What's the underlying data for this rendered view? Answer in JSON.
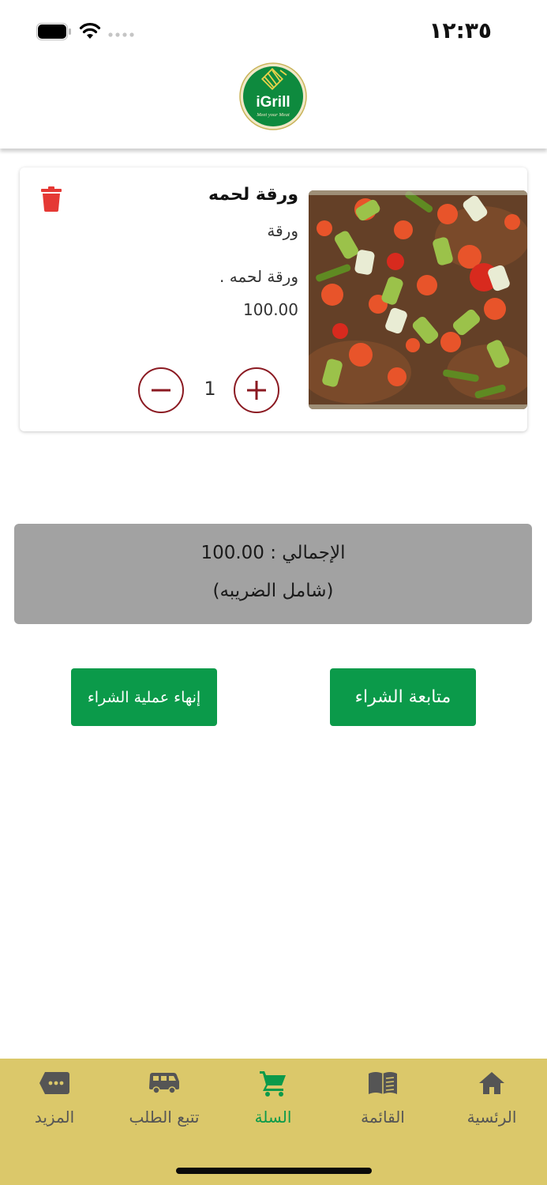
{
  "status_bar": {
    "time": "١٢:٣٥"
  },
  "header": {
    "logo_text": "iGrill",
    "logo_tagline": "Meet your Meat"
  },
  "cart_item": {
    "name": "ورقة لحمه",
    "subtitle": "ورقة",
    "description": "ورقة لحمه .",
    "price": "100.00",
    "quantity": "1"
  },
  "total": {
    "line": "الإجمالي : 100.00",
    "tax_note": "(شامل الضريبه)"
  },
  "actions": {
    "continue_label": "متابعة الشراء",
    "checkout_label": "إنهاء عملية الشراء"
  },
  "tabs": [
    {
      "label": "الرئسية",
      "icon": "home-icon"
    },
    {
      "label": "القائمة",
      "icon": "menu-book-icon"
    },
    {
      "label": "السلة",
      "icon": "cart-icon",
      "active": true
    },
    {
      "label": "تتبع الطلب",
      "icon": "delivery-van-icon"
    },
    {
      "label": "المزيد",
      "icon": "more-dots-icon"
    }
  ],
  "colors": {
    "brand_green": "#0b9a4a",
    "tabbar_bg": "#dbc86a",
    "delete_red": "#e53935",
    "stepper_red": "#8b1a22",
    "total_bg": "#a2a2a2"
  }
}
